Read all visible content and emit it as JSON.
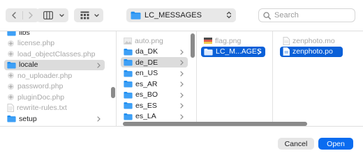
{
  "toolbar": {
    "path_label": "LC_MESSAGES",
    "search_placeholder": "Search"
  },
  "columns": [
    {
      "items": [
        {
          "name": "libs",
          "type": "folder",
          "dim": false
        },
        {
          "name": "license.php",
          "type": "php",
          "dim": true
        },
        {
          "name": "load_objectClasses.php",
          "type": "php",
          "dim": true
        },
        {
          "name": "locale",
          "type": "folder",
          "dim": false,
          "selected": "gray",
          "chevron": true
        },
        {
          "name": "no_uploader.php",
          "type": "php",
          "dim": true
        },
        {
          "name": "password.php",
          "type": "php",
          "dim": true
        },
        {
          "name": "pluginDoc.php",
          "type": "php",
          "dim": true
        },
        {
          "name": "rewrite-rules.txt",
          "type": "txt",
          "dim": true
        },
        {
          "name": "setup",
          "type": "folder",
          "dim": false,
          "chevron": true
        }
      ]
    },
    {
      "items": [
        {
          "name": "auto.png",
          "type": "png",
          "dim": true
        },
        {
          "name": "da_DK",
          "type": "folder",
          "dim": false,
          "chevron": true
        },
        {
          "name": "de_DE",
          "type": "folder",
          "dim": false,
          "selected": "gray",
          "chevron": true
        },
        {
          "name": "en_US",
          "type": "folder",
          "dim": false,
          "chevron": true
        },
        {
          "name": "es_AR",
          "type": "folder",
          "dim": false,
          "chevron": true
        },
        {
          "name": "es_BO",
          "type": "folder",
          "dim": false,
          "chevron": true
        },
        {
          "name": "es_ES",
          "type": "folder",
          "dim": false,
          "chevron": true
        },
        {
          "name": "es_LA",
          "type": "folder",
          "dim": false,
          "chevron": true
        }
      ]
    },
    {
      "items": [
        {
          "name": "flag.png",
          "type": "flag",
          "dim": true
        },
        {
          "name": "LC_M...AGES",
          "type": "folder",
          "dim": false,
          "selected": "blue",
          "chevron": true
        }
      ]
    },
    {
      "items": [
        {
          "name": "zenphoto.mo",
          "type": "doc",
          "dim": true
        },
        {
          "name": "zenphoto.po",
          "type": "doc",
          "dim": false,
          "selected": "blue"
        }
      ]
    }
  ],
  "footer": {
    "cancel_label": "Cancel",
    "open_label": "Open"
  },
  "colors": {
    "accent": "#0a6cf0",
    "selection_blue": "#0a60d8",
    "selection_gray": "#dcdcdc",
    "folder_blue": "#1e8ef0"
  }
}
